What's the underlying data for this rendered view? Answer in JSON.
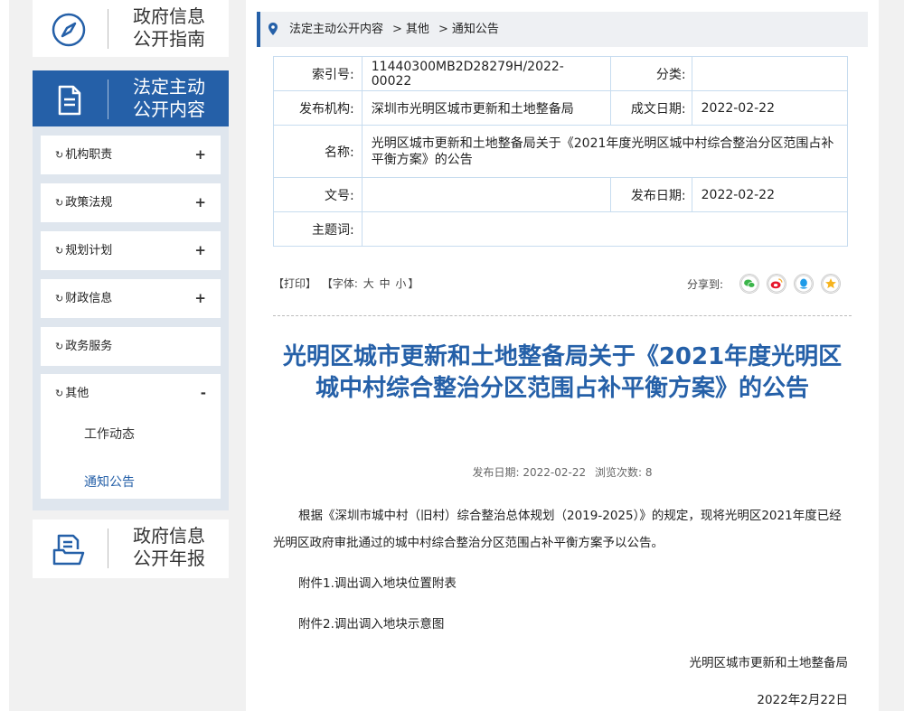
{
  "sidebar": {
    "guide_card": {
      "line1": "政府信息",
      "line2": "公开指南",
      "icon": "compass-icon"
    },
    "active_card": {
      "line1": "法定主动",
      "line2": "公开内容",
      "icon": "document-icon"
    },
    "report_card": {
      "line1": "政府信息",
      "line2": "公开年报",
      "icon": "folder-doc-icon"
    },
    "menu": [
      {
        "label": "机构职责",
        "toggle": "+"
      },
      {
        "label": "政策法规",
        "toggle": "+"
      },
      {
        "label": "规划计划",
        "toggle": "+"
      },
      {
        "label": "财政信息",
        "toggle": "+"
      },
      {
        "label": "政务服务",
        "toggle": ""
      },
      {
        "label": "其他",
        "toggle": "-"
      }
    ],
    "submenu": [
      {
        "label": "工作动态",
        "state": "normal"
      },
      {
        "label": "通知公告",
        "state": "current"
      }
    ],
    "accent_color": "#2560a8"
  },
  "breadcrumb": {
    "items": [
      "法定主动公开内容",
      "其他",
      "通知公告"
    ],
    "separator": ">"
  },
  "meta": {
    "index_label": "索引号:",
    "index_value": "11440300MB2D28279H/2022-00022",
    "category_label": "分类:",
    "category_value": "",
    "publisher_label": "发布机构:",
    "publisher_value": "深圳市光明区城市更新和土地整备局",
    "written_date_label": "成文日期:",
    "written_date_value": "2022-02-22",
    "name_label": "名称:",
    "name_value": "光明区城市更新和土地整备局关于《2021年度光明区城中村综合整治分区范围占补平衡方案》的公告",
    "doc_no_label": "文号:",
    "doc_no_value": "",
    "publish_date_label": "发布日期:",
    "publish_date_value": "2022-02-22",
    "subject_label": "主题词:",
    "subject_value": ""
  },
  "tools": {
    "print": "【打印】",
    "font_prefix": "【字体:",
    "font_large": "大",
    "font_medium": "中",
    "font_small": "小",
    "font_suffix": "】",
    "share_label": "分享到:",
    "share_icons": [
      "wechat-icon",
      "weibo-icon",
      "qq-icon",
      "qzone-icon"
    ]
  },
  "article": {
    "title": "光明区城市更新和土地整备局关于《2021年度光明区城中村综合整治分区范围占补平衡方案》的公告",
    "pub_date_text": "发布日期: 2022-02-22",
    "views_text": "浏览次数: 8",
    "body": "根据《深圳市城中村（旧村）综合整治总体规划（2019-2025）》的规定，现将光明区2021年度已经光明区政府审批通过的城中村综合整治分区范围占补平衡方案予以公告。",
    "attachment1": "附件1.调出调入地块位置附表",
    "attachment2": "附件2.调出调入地块示意图",
    "signature": "光明区城市更新和土地整备局",
    "date": "2022年2月22日"
  }
}
